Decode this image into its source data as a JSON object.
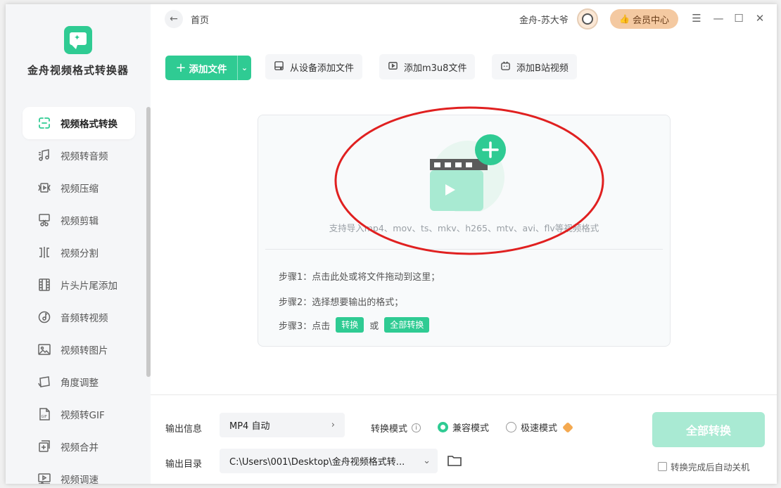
{
  "app": {
    "title": "金舟视频格式转换器"
  },
  "sidebar": {
    "items": [
      {
        "label": "视频格式转换",
        "icon": "convert-icon",
        "active": true
      },
      {
        "label": "视频转音频",
        "icon": "music-note-icon"
      },
      {
        "label": "视频压缩",
        "icon": "compress-icon"
      },
      {
        "label": "视频剪辑",
        "icon": "scissors-icon"
      },
      {
        "label": "视频分割",
        "icon": "split-icon"
      },
      {
        "label": "片头片尾添加",
        "icon": "film-strip-icon"
      },
      {
        "label": "音频转视频",
        "icon": "music-disc-icon"
      },
      {
        "label": "视频转图片",
        "icon": "image-icon"
      },
      {
        "label": "角度调整",
        "icon": "rotate-icon"
      },
      {
        "label": "视频转GIF",
        "icon": "gif-file-icon"
      },
      {
        "label": "视频合并",
        "icon": "merge-icon"
      },
      {
        "label": "视频调速",
        "icon": "speed-icon"
      }
    ]
  },
  "header": {
    "breadcrumb": "首页",
    "user_name": "金舟-苏大爷",
    "vip_label": "会员中心"
  },
  "toolbar": {
    "add_file_label": "添加文件",
    "add_from_device_label": "从设备添加文件",
    "add_m3u8_label": "添加m3u8文件",
    "add_bilibili_label": "添加B站视频"
  },
  "drop_area": {
    "support_text": "支持导入mp4、mov、ts、mkv、h265、mtv、avi、flv等视频格式",
    "step1": "步骤1：点击此处或将文件拖动到这里；",
    "step2": "步骤2：选择想要输出的格式；",
    "step3_prefix": "步骤3：点击",
    "step3_convert": "转换",
    "step3_or": "或",
    "step3_convert_all": "全部转换"
  },
  "bottom": {
    "output_info_label": "输出信息",
    "output_format_value": "MP4 自动",
    "convert_mode_label": "转换模式",
    "mode_compatible": "兼容模式",
    "mode_fast": "极速模式",
    "output_dir_label": "输出目录",
    "output_dir_value": "C:\\Users\\001\\Desktop\\金舟视频格式转...",
    "convert_all_label": "全部转换",
    "shutdown_label": "转换完成后自动关机"
  },
  "colors": {
    "accent": "#2fcb93",
    "accent_light": "#a9ead3",
    "annotation_red": "#e02020",
    "vip_bg": "#f4c9a1"
  }
}
